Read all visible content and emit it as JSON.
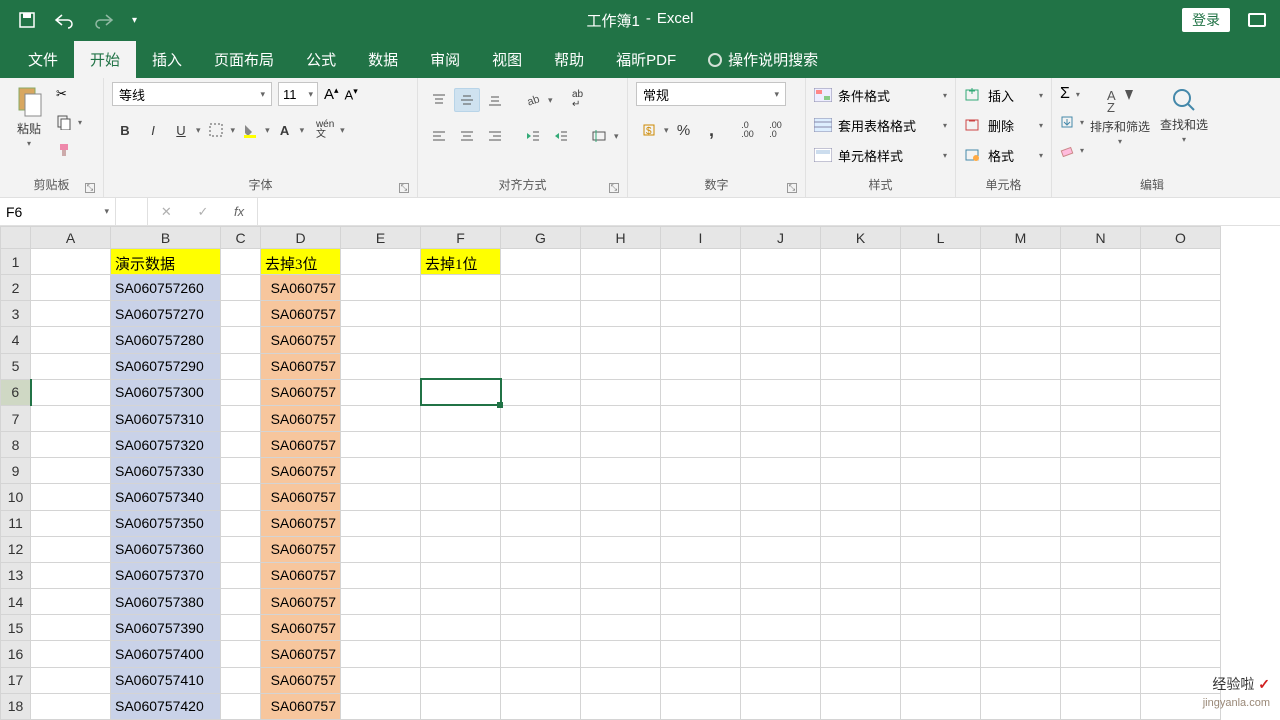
{
  "title": {
    "workbook": "工作簿1",
    "separator": "-",
    "app": "Excel"
  },
  "login": "登录",
  "tabs": [
    "文件",
    "开始",
    "插入",
    "页面布局",
    "公式",
    "数据",
    "审阅",
    "视图",
    "帮助",
    "福昕PDF"
  ],
  "active_tab": 1,
  "tell_me": "操作说明搜索",
  "ribbon": {
    "clipboard": {
      "label": "剪贴板",
      "paste": "粘贴"
    },
    "font": {
      "label": "字体",
      "name": "等线",
      "size": "11"
    },
    "align": {
      "label": "对齐方式"
    },
    "number": {
      "label": "数字",
      "format": "常规"
    },
    "styles": {
      "label": "样式",
      "cond": "条件格式",
      "table": "套用表格格式",
      "cell": "单元格样式"
    },
    "cells": {
      "label": "单元格",
      "insert": "插入",
      "delete": "删除",
      "format": "格式"
    },
    "editing": {
      "label": "编辑",
      "sort": "排序和筛选",
      "find": "查找和选"
    }
  },
  "namebox": "F6",
  "formula": "",
  "columns": [
    "A",
    "B",
    "C",
    "D",
    "E",
    "F",
    "G",
    "H",
    "I",
    "J",
    "K",
    "L",
    "M",
    "N",
    "O"
  ],
  "rows": [
    1,
    2,
    3,
    4,
    5,
    6,
    7,
    8,
    9,
    10,
    11,
    12,
    13,
    14,
    15,
    16,
    17,
    18
  ],
  "headers": {
    "B": "演示数据",
    "D": "去掉3位",
    "F": "去掉1位"
  },
  "col_b": [
    "SA060757260",
    "SA060757270",
    "SA060757280",
    "SA060757290",
    "SA060757300",
    "SA060757310",
    "SA060757320",
    "SA060757330",
    "SA060757340",
    "SA060757350",
    "SA060757360",
    "SA060757370",
    "SA060757380",
    "SA060757390",
    "SA060757400",
    "SA060757410",
    "SA060757420"
  ],
  "col_d": [
    "SA060757",
    "SA060757",
    "SA060757",
    "SA060757",
    "SA060757",
    "SA060757",
    "SA060757",
    "SA060757",
    "SA060757",
    "SA060757",
    "SA060757",
    "SA060757",
    "SA060757",
    "SA060757",
    "SA060757",
    "SA060757",
    "SA060757"
  ],
  "selected_cell": "F6",
  "watermark": {
    "line1": "经验啦",
    "line2": "jingyanla.com"
  }
}
